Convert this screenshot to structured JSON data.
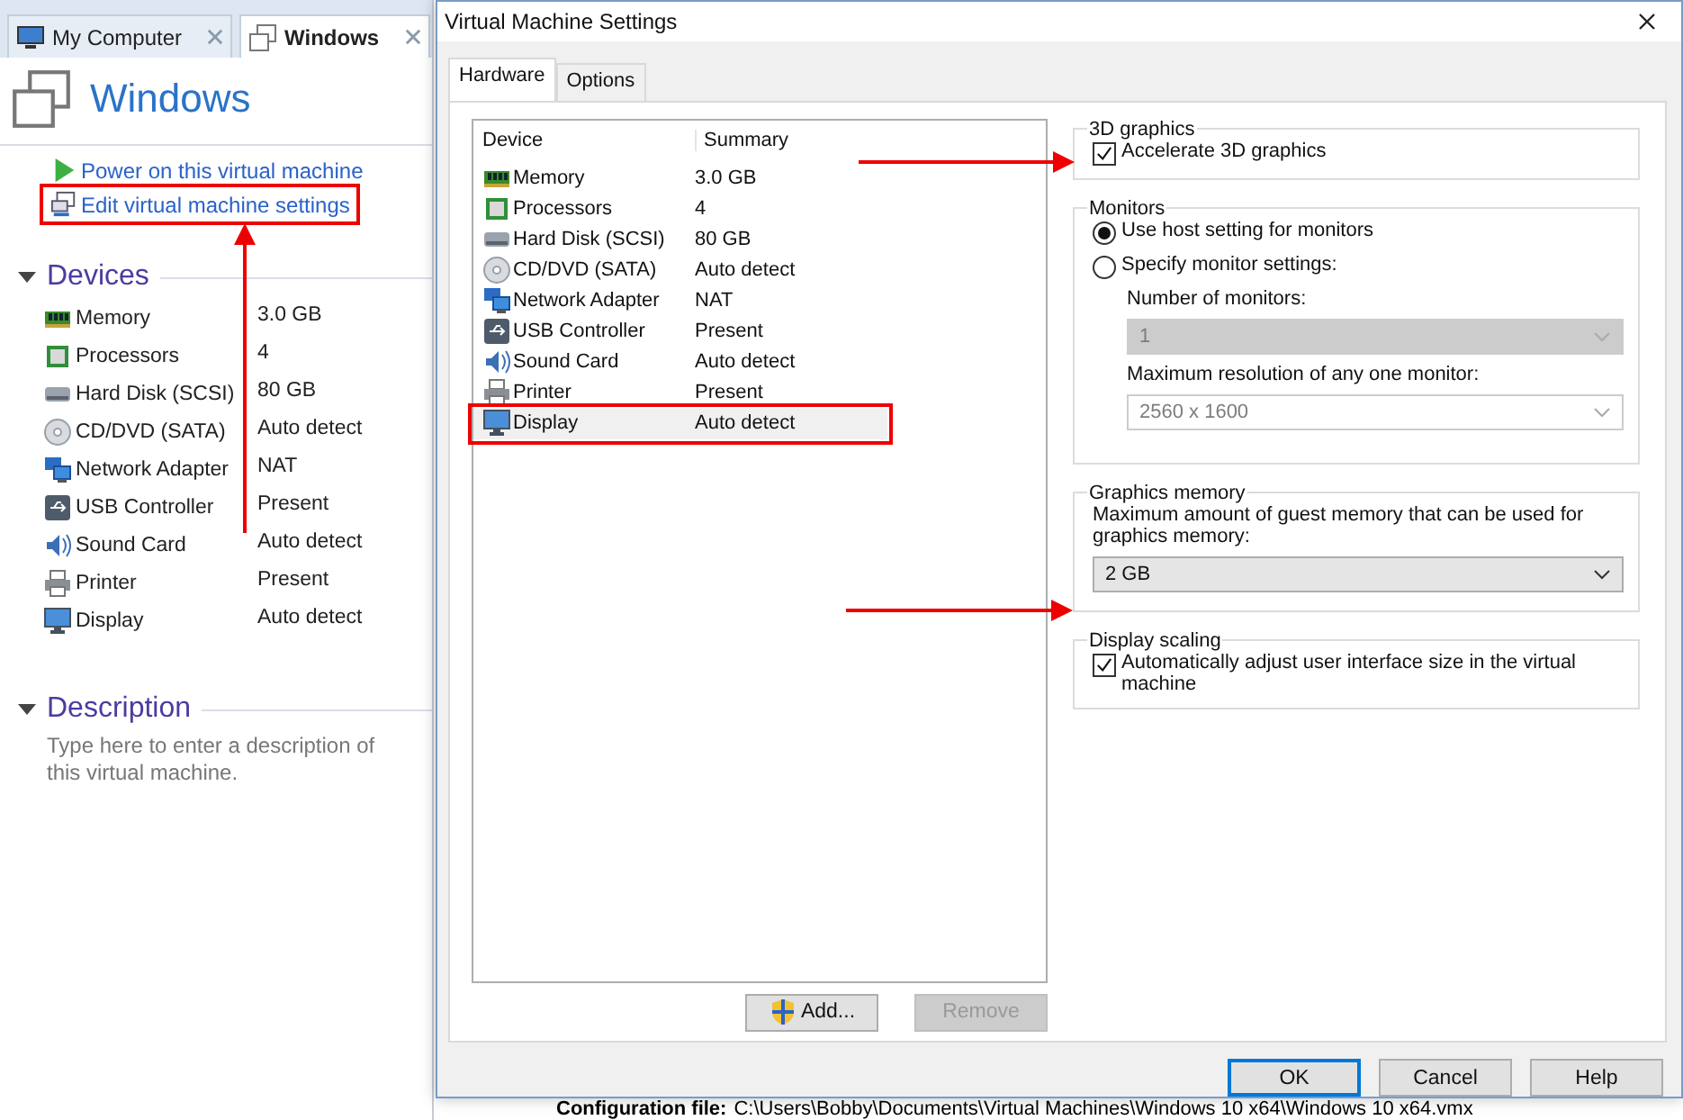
{
  "app": {
    "tabs": [
      {
        "kind": "computer",
        "label": "My Computer",
        "selected": false
      },
      {
        "kind": "vm",
        "label": "Windows",
        "selected": true
      }
    ],
    "vm_title": "Windows",
    "actions": [
      {
        "kind": "power",
        "label": "Power on this virtual machine",
        "highlighted": false
      },
      {
        "kind": "edit",
        "label": "Edit virtual machine settings",
        "highlighted": true
      }
    ],
    "devices_heading": "Devices",
    "devices": [
      {
        "kind": "memory",
        "name": "Memory",
        "value": "3.0 GB"
      },
      {
        "kind": "processor",
        "name": "Processors",
        "value": "4"
      },
      {
        "kind": "disk",
        "name": "Hard Disk (SCSI)",
        "value": "80 GB"
      },
      {
        "kind": "cd",
        "name": "CD/DVD (SATA)",
        "value": "Auto detect"
      },
      {
        "kind": "network",
        "name": "Network Adapter",
        "value": "NAT"
      },
      {
        "kind": "usb",
        "name": "USB Controller",
        "value": "Present"
      },
      {
        "kind": "sound",
        "name": "Sound Card",
        "value": "Auto detect"
      },
      {
        "kind": "printer",
        "name": "Printer",
        "value": "Present"
      },
      {
        "kind": "display",
        "name": "Display",
        "value": "Auto detect"
      }
    ],
    "description_heading": "Description",
    "description_placeholder": "Type here to enter a description of this virtual machine.",
    "config_label": "Configuration file:",
    "config_value": "C:\\Users\\Bobby\\Documents\\Virtual Machines\\Windows 10 x64\\Windows 10 x64.vmx"
  },
  "dialog": {
    "title": "Virtual Machine Settings",
    "tabs": [
      {
        "label": "Hardware",
        "selected": true
      },
      {
        "label": "Options",
        "selected": false
      }
    ],
    "columns": [
      "Device",
      "Summary"
    ],
    "rows": [
      {
        "kind": "memory",
        "device": "Memory",
        "summary": "3.0 GB",
        "selected": false,
        "highlighted": false
      },
      {
        "kind": "processor",
        "device": "Processors",
        "summary": "4",
        "selected": false,
        "highlighted": false
      },
      {
        "kind": "disk",
        "device": "Hard Disk (SCSI)",
        "summary": "80 GB",
        "selected": false,
        "highlighted": false
      },
      {
        "kind": "cd",
        "device": "CD/DVD (SATA)",
        "summary": "Auto detect",
        "selected": false,
        "highlighted": false
      },
      {
        "kind": "network",
        "device": "Network Adapter",
        "summary": "NAT",
        "selected": false,
        "highlighted": false
      },
      {
        "kind": "usb",
        "device": "USB Controller",
        "summary": "Present",
        "selected": false,
        "highlighted": false
      },
      {
        "kind": "sound",
        "device": "Sound Card",
        "summary": "Auto detect",
        "selected": false,
        "highlighted": false
      },
      {
        "kind": "printer",
        "device": "Printer",
        "summary": "Present",
        "selected": false,
        "highlighted": false
      },
      {
        "kind": "display",
        "device": "Display",
        "summary": "Auto detect",
        "selected": true,
        "highlighted": true
      }
    ],
    "list_buttons": [
      {
        "kind": "add",
        "label": "Add...",
        "disabled": false
      },
      {
        "kind": "remove",
        "label": "Remove",
        "disabled": true
      }
    ],
    "groups": [
      {
        "title": "3D graphics",
        "items": [
          {
            "kind": "checkbox",
            "label": "Accelerate 3D graphics",
            "checked": true
          }
        ]
      },
      {
        "title": "Monitors",
        "items": [
          {
            "kind": "radio",
            "label": "Use host setting for monitors",
            "selected": true
          },
          {
            "kind": "radio",
            "label": "Specify monitor settings:",
            "selected": false
          },
          {
            "kind": "label",
            "label": "Number of monitors:"
          },
          {
            "kind": "dropdown",
            "value": "1",
            "disabled": true
          },
          {
            "kind": "label",
            "label": "Maximum resolution of any one monitor:"
          },
          {
            "kind": "dropdown",
            "value": "2560 x 1600",
            "disabled": true
          }
        ]
      },
      {
        "title": "Graphics memory",
        "items": [
          {
            "kind": "text",
            "label": "Maximum amount of guest memory that can be used for graphics memory:"
          },
          {
            "kind": "dropdown",
            "value": "2 GB",
            "disabled": false
          }
        ]
      },
      {
        "title": "Display scaling",
        "items": [
          {
            "kind": "checkbox",
            "label": "Automatically adjust user interface size in the virtual machine",
            "checked": true
          }
        ]
      }
    ],
    "footer_buttons": [
      {
        "label": "OK",
        "default": true
      },
      {
        "label": "Cancel",
        "default": false
      },
      {
        "label": "Help",
        "default": false
      }
    ]
  }
}
